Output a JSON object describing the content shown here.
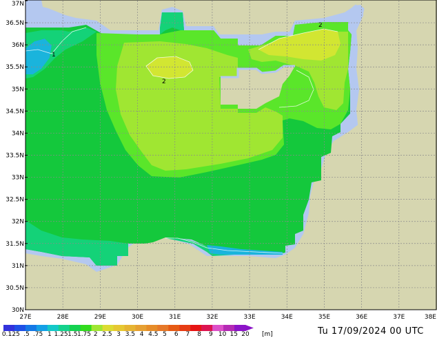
{
  "map": {
    "lat_labels": [
      "37N",
      "36.5N",
      "36N",
      "35.5N",
      "35N",
      "34.5N",
      "34N",
      "33.5N",
      "33N",
      "32.5N",
      "32N",
      "31.5N",
      "31N",
      "30.5N",
      "30N"
    ],
    "lon_labels": [
      "27E",
      "28E",
      "29E",
      "30E",
      "31E",
      "32E",
      "33E",
      "34E",
      "35E",
      "36E",
      "37E",
      "38E"
    ],
    "contour_labels": [
      "1",
      "2",
      "2"
    ],
    "colors": {
      "land": "#d6d6b0",
      "sea_shallow": "#b4c8f0",
      "grid": "#8a8a8a",
      "lvl_075": "#1ab4dc",
      "lvl_1": "#14d278",
      "lvl_125": "#14c83c",
      "lvl_15": "#5ae62a",
      "lvl_175": "#a0e632",
      "lvl_2": "#d2e632"
    }
  },
  "colorbar": {
    "labels": [
      "0.1",
      ".25",
      ".5",
      ".75",
      "1",
      "1.25",
      "1.5",
      "1.75",
      "2",
      "2.5",
      "3",
      "3.5",
      "4",
      "4.5",
      "5",
      "6",
      "7",
      "8",
      "9",
      "10",
      "15",
      "20"
    ],
    "unit": "[m]",
    "colors": [
      "#3232dc",
      "#1e50e6",
      "#1478e6",
      "#14a0e6",
      "#14c8c8",
      "#14d28c",
      "#14d250",
      "#32dc1e",
      "#a0e632",
      "#dcdc32",
      "#e6c832",
      "#e6b432",
      "#e6a032",
      "#e68c28",
      "#e67828",
      "#e65a14",
      "#e63c14",
      "#e61414",
      "#dc1450",
      "#dc50c8",
      "#b42ab4",
      "#8c14c8"
    ]
  },
  "footer": {
    "datetime": "Tu 17/09/2024 00 UTC"
  }
}
